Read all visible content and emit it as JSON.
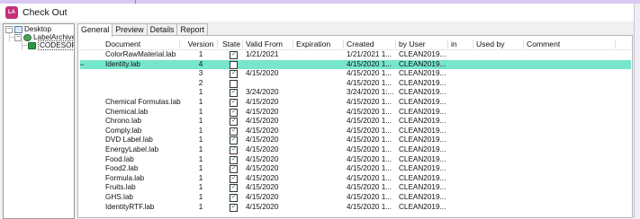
{
  "window": {
    "title": "Check Out",
    "app_icon_text": "LA"
  },
  "tree": {
    "items": [
      {
        "label": "Desktop",
        "expander": "−"
      },
      {
        "label": "LabelArchive",
        "expander": "−"
      },
      {
        "label": "CODESOF"
      }
    ]
  },
  "tabs": [
    {
      "label": "General",
      "active": true
    },
    {
      "label": "Preview"
    },
    {
      "label": "Details"
    },
    {
      "label": "Report"
    }
  ],
  "table": {
    "columns": [
      "Document",
      "Version",
      "State",
      "Valid From",
      "Expiration",
      "Created",
      "by User",
      "in",
      "Used by",
      "Comment"
    ],
    "rows": [
      {
        "document": "ColorRawMaterial.lab",
        "version": "1",
        "state": "checked",
        "valid_from": "1/21/2021",
        "created": "1/21/2021 1...",
        "by_user": "CLEAN2019..."
      },
      {
        "document": "Identity.lab",
        "version": "4",
        "state": "unchecked",
        "valid_from": "",
        "created": "4/15/2020 1...",
        "by_user": "CLEAN2019...",
        "highlighted": true,
        "prefix": "−"
      },
      {
        "document": "",
        "version": "3",
        "state": "checked",
        "valid_from": "4/15/2020",
        "created": "4/15/2020 1...",
        "by_user": "CLEAN2019..."
      },
      {
        "document": "",
        "version": "2",
        "state": "unchecked",
        "valid_from": "",
        "created": "4/15/2020 1...",
        "by_user": "CLEAN2019..."
      },
      {
        "document": "",
        "version": "1",
        "state": "checked",
        "valid_from": "3/24/2020",
        "created": "3/24/2020 1:...",
        "by_user": "CLEAN2019..."
      },
      {
        "document": "Chemical Formulas.lab",
        "version": "1",
        "state": "checked",
        "valid_from": "4/15/2020",
        "created": "4/15/2020 1...",
        "by_user": "CLEAN2019..."
      },
      {
        "document": "Chemical.lab",
        "version": "1",
        "state": "checked",
        "valid_from": "4/15/2020",
        "created": "4/15/2020 1...",
        "by_user": "CLEAN2019..."
      },
      {
        "document": "Chrono.lab",
        "version": "1",
        "state": "checked",
        "valid_from": "4/15/2020",
        "created": "4/15/2020 1...",
        "by_user": "CLEAN2019..."
      },
      {
        "document": "Comply.lab",
        "version": "1",
        "state": "checked",
        "valid_from": "4/15/2020",
        "created": "4/15/2020 1...",
        "by_user": "CLEAN2019..."
      },
      {
        "document": "DVD Label.lab",
        "version": "1",
        "state": "checked",
        "valid_from": "4/15/2020",
        "created": "4/15/2020 1...",
        "by_user": "CLEAN2019..."
      },
      {
        "document": "EnergyLabel.lab",
        "version": "1",
        "state": "checked",
        "valid_from": "4/15/2020",
        "created": "4/15/2020 1...",
        "by_user": "CLEAN2019..."
      },
      {
        "document": "Food.lab",
        "version": "1",
        "state": "checked",
        "valid_from": "4/15/2020",
        "created": "4/15/2020 1...",
        "by_user": "CLEAN2019..."
      },
      {
        "document": "Food2.lab",
        "version": "1",
        "state": "checked",
        "valid_from": "4/15/2020",
        "created": "4/15/2020 1...",
        "by_user": "CLEAN2019..."
      },
      {
        "document": "Formula.lab",
        "version": "1",
        "state": "checked",
        "valid_from": "4/15/2020",
        "created": "4/15/2020 1...",
        "by_user": "CLEAN2019..."
      },
      {
        "document": "Fruits.lab",
        "version": "1",
        "state": "checked",
        "valid_from": "4/15/2020",
        "created": "4/15/2020 1...",
        "by_user": "CLEAN2019..."
      },
      {
        "document": "GHS.lab",
        "version": "1",
        "state": "checked",
        "valid_from": "4/15/2020",
        "created": "4/15/2020 1...",
        "by_user": "CLEAN2019..."
      },
      {
        "document": "IdentityRTF.lab",
        "version": "1",
        "state": "checked",
        "valid_from": "4/15/2020",
        "created": "4/15/2020 1...",
        "by_user": "CLEAN2019..."
      }
    ]
  },
  "colors": {
    "highlight_row": "#76e6cc",
    "app_icon": "#c4307a",
    "background_tint": "#f1eff6"
  }
}
